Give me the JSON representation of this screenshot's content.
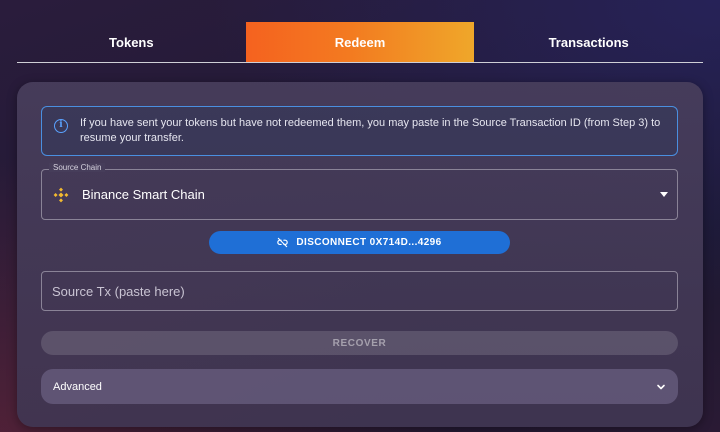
{
  "tabs": [
    {
      "label": "Tokens",
      "active": false
    },
    {
      "label": "Redeem",
      "active": true
    },
    {
      "label": "Transactions",
      "active": false
    }
  ],
  "alert": {
    "icon": "info-icon",
    "text": "If you have sent your tokens but have not redeemed them, you may paste in the Source Transaction ID (from Step 3) to resume your transfer."
  },
  "source_chain": {
    "label": "Source Chain",
    "value": "Binance Smart Chain",
    "icon": "bnb-chain-icon"
  },
  "wallet": {
    "disconnect_label": "DISCONNECT 0X714D...4296",
    "icon": "link-off-icon"
  },
  "source_tx": {
    "placeholder": "Source Tx (paste here)",
    "value": ""
  },
  "recover": {
    "label": "RECOVER",
    "enabled": false
  },
  "advanced": {
    "label": "Advanced",
    "icon": "chevron-down-icon"
  },
  "colors": {
    "tab_active_start": "#f5621f",
    "tab_active_end": "#efa72a",
    "primary_button": "#1f6fd6",
    "info_border": "#4a8fe0",
    "bnb": "#f3ba2f"
  }
}
